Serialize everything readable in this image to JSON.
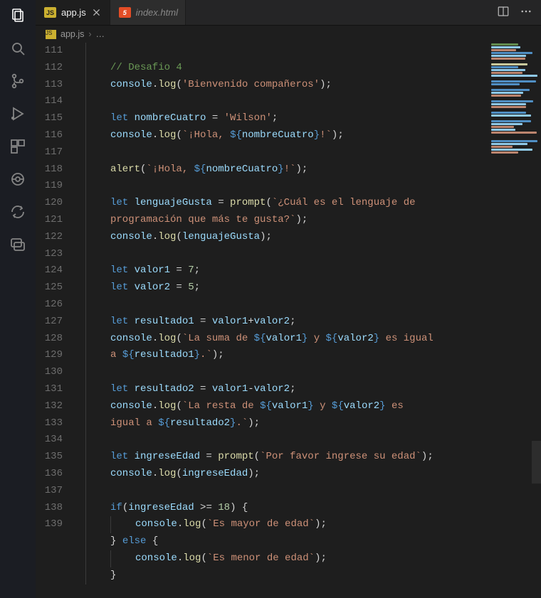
{
  "tabs": [
    {
      "label": "app.js",
      "badge": "JS",
      "active": true
    },
    {
      "label": "index.html",
      "badge": "5",
      "active": false
    }
  ],
  "breadcrumb": {
    "file": "app.js",
    "badge": "JS",
    "trail": "…"
  },
  "gutter_start": 111,
  "code_lines": [
    {
      "n": 111,
      "indent": 1,
      "tokens": []
    },
    {
      "n": 112,
      "indent": 1,
      "tokens": [
        [
          "comment",
          "// Desafio 4"
        ]
      ]
    },
    {
      "n": 113,
      "indent": 1,
      "tokens": [
        [
          "var",
          "console"
        ],
        [
          "punc",
          "."
        ],
        [
          "func",
          "log"
        ],
        [
          "punc",
          "("
        ],
        [
          "string",
          "'Bienvenido compañeros'"
        ],
        [
          "punc",
          ");"
        ]
      ]
    },
    {
      "n": 114,
      "indent": 1,
      "tokens": []
    },
    {
      "n": 115,
      "indent": 1,
      "tokens": [
        [
          "keyword",
          "let "
        ],
        [
          "var",
          "nombreCuatro"
        ],
        [
          "punc",
          " = "
        ],
        [
          "string",
          "'Wilson'"
        ],
        [
          "punc",
          ";"
        ]
      ]
    },
    {
      "n": 116,
      "indent": 1,
      "tokens": [
        [
          "var",
          "console"
        ],
        [
          "punc",
          "."
        ],
        [
          "func",
          "log"
        ],
        [
          "punc",
          "("
        ],
        [
          "string",
          "`¡Hola, "
        ],
        [
          "tpl",
          "${"
        ],
        [
          "var",
          "nombreCuatro"
        ],
        [
          "tpl",
          "}"
        ],
        [
          "string",
          "!`"
        ],
        [
          "punc",
          ");"
        ]
      ]
    },
    {
      "n": 117,
      "indent": 1,
      "tokens": []
    },
    {
      "n": 118,
      "indent": 1,
      "tokens": [
        [
          "func",
          "alert"
        ],
        [
          "punc",
          "("
        ],
        [
          "string",
          "`¡Hola, "
        ],
        [
          "tpl",
          "${"
        ],
        [
          "var",
          "nombreCuatro"
        ],
        [
          "tpl",
          "}"
        ],
        [
          "string",
          "!`"
        ],
        [
          "punc",
          ");"
        ]
      ]
    },
    {
      "n": 119,
      "indent": 1,
      "tokens": []
    },
    {
      "n": 120,
      "indent": 1,
      "tokens": [
        [
          "keyword",
          "let "
        ],
        [
          "var",
          "lenguajeGusta"
        ],
        [
          "punc",
          " = "
        ],
        [
          "func",
          "prompt"
        ],
        [
          "punc",
          "("
        ],
        [
          "string",
          "`¿Cuál es el lenguaje de "
        ]
      ]
    },
    {
      "wrap": true,
      "indent": 1,
      "tokens": [
        [
          "string",
          "programación que más te gusta?`"
        ],
        [
          "punc",
          ");"
        ]
      ]
    },
    {
      "n": 121,
      "indent": 1,
      "tokens": [
        [
          "var",
          "console"
        ],
        [
          "punc",
          "."
        ],
        [
          "func",
          "log"
        ],
        [
          "punc",
          "("
        ],
        [
          "var",
          "lenguajeGusta"
        ],
        [
          "punc",
          ");"
        ]
      ]
    },
    {
      "n": 122,
      "indent": 1,
      "tokens": []
    },
    {
      "n": 123,
      "indent": 1,
      "tokens": [
        [
          "keyword",
          "let "
        ],
        [
          "var",
          "valor1"
        ],
        [
          "punc",
          " = "
        ],
        [
          "number",
          "7"
        ],
        [
          "punc",
          ";"
        ]
      ]
    },
    {
      "n": 124,
      "indent": 1,
      "tokens": [
        [
          "keyword",
          "let "
        ],
        [
          "var",
          "valor2"
        ],
        [
          "punc",
          " = "
        ],
        [
          "number",
          "5"
        ],
        [
          "punc",
          ";"
        ]
      ]
    },
    {
      "n": 125,
      "indent": 1,
      "tokens": []
    },
    {
      "n": 126,
      "indent": 1,
      "tokens": [
        [
          "keyword",
          "let "
        ],
        [
          "var",
          "resultado1"
        ],
        [
          "punc",
          " = "
        ],
        [
          "var",
          "valor1"
        ],
        [
          "punc",
          "+"
        ],
        [
          "var",
          "valor2"
        ],
        [
          "punc",
          ";"
        ]
      ]
    },
    {
      "n": 127,
      "indent": 1,
      "tokens": [
        [
          "var",
          "console"
        ],
        [
          "punc",
          "."
        ],
        [
          "func",
          "log"
        ],
        [
          "punc",
          "("
        ],
        [
          "string",
          "`La suma de "
        ],
        [
          "tpl",
          "${"
        ],
        [
          "var",
          "valor1"
        ],
        [
          "tpl",
          "}"
        ],
        [
          "string",
          " y "
        ],
        [
          "tpl",
          "${"
        ],
        [
          "var",
          "valor2"
        ],
        [
          "tpl",
          "}"
        ],
        [
          "string",
          " es igual "
        ]
      ]
    },
    {
      "wrap": true,
      "indent": 1,
      "tokens": [
        [
          "string",
          "a "
        ],
        [
          "tpl",
          "${"
        ],
        [
          "var",
          "resultado1"
        ],
        [
          "tpl",
          "}"
        ],
        [
          "string",
          ".`"
        ],
        [
          "punc",
          ");"
        ]
      ]
    },
    {
      "n": 128,
      "indent": 1,
      "tokens": []
    },
    {
      "n": 129,
      "indent": 1,
      "tokens": [
        [
          "keyword",
          "let "
        ],
        [
          "var",
          "resultado2"
        ],
        [
          "punc",
          " = "
        ],
        [
          "var",
          "valor1"
        ],
        [
          "punc",
          "-"
        ],
        [
          "var",
          "valor2"
        ],
        [
          "punc",
          ";"
        ]
      ]
    },
    {
      "n": 130,
      "indent": 1,
      "tokens": [
        [
          "var",
          "console"
        ],
        [
          "punc",
          "."
        ],
        [
          "func",
          "log"
        ],
        [
          "punc",
          "("
        ],
        [
          "string",
          "`La resta de "
        ],
        [
          "tpl",
          "${"
        ],
        [
          "var",
          "valor1"
        ],
        [
          "tpl",
          "}"
        ],
        [
          "string",
          " y "
        ],
        [
          "tpl",
          "${"
        ],
        [
          "var",
          "valor2"
        ],
        [
          "tpl",
          "}"
        ],
        [
          "string",
          " es "
        ]
      ]
    },
    {
      "wrap": true,
      "indent": 1,
      "tokens": [
        [
          "string",
          "igual a "
        ],
        [
          "tpl",
          "${"
        ],
        [
          "var",
          "resultado2"
        ],
        [
          "tpl",
          "}"
        ],
        [
          "string",
          ".`"
        ],
        [
          "punc",
          ");"
        ]
      ]
    },
    {
      "n": 131,
      "indent": 1,
      "tokens": []
    },
    {
      "n": 132,
      "indent": 1,
      "tokens": [
        [
          "keyword",
          "let "
        ],
        [
          "var",
          "ingreseEdad"
        ],
        [
          "punc",
          " = "
        ],
        [
          "func",
          "prompt"
        ],
        [
          "punc",
          "("
        ],
        [
          "string",
          "`Por favor ingrese su edad`"
        ],
        [
          "punc",
          ");"
        ]
      ]
    },
    {
      "n": 133,
      "indent": 1,
      "tokens": [
        [
          "var",
          "console"
        ],
        [
          "punc",
          "."
        ],
        [
          "func",
          "log"
        ],
        [
          "punc",
          "("
        ],
        [
          "var",
          "ingreseEdad"
        ],
        [
          "punc",
          ");"
        ]
      ]
    },
    {
      "n": 134,
      "indent": 1,
      "tokens": []
    },
    {
      "n": 135,
      "indent": 1,
      "tokens": [
        [
          "keyword",
          "if"
        ],
        [
          "punc",
          "("
        ],
        [
          "var",
          "ingreseEdad"
        ],
        [
          "punc",
          " >= "
        ],
        [
          "number",
          "18"
        ],
        [
          "punc",
          ") {"
        ]
      ]
    },
    {
      "n": 136,
      "indent": 2,
      "tokens": [
        [
          "var",
          "console"
        ],
        [
          "punc",
          "."
        ],
        [
          "func",
          "log"
        ],
        [
          "punc",
          "("
        ],
        [
          "string",
          "`Es mayor de edad`"
        ],
        [
          "punc",
          ");"
        ]
      ]
    },
    {
      "n": 137,
      "indent": 1,
      "tokens": [
        [
          "punc",
          "} "
        ],
        [
          "keyword",
          "else"
        ],
        [
          "punc",
          " {"
        ]
      ]
    },
    {
      "n": 138,
      "indent": 2,
      "tokens": [
        [
          "var",
          "console"
        ],
        [
          "punc",
          "."
        ],
        [
          "func",
          "log"
        ],
        [
          "punc",
          "("
        ],
        [
          "string",
          "`Es menor de edad`"
        ],
        [
          "punc",
          ");"
        ]
      ]
    },
    {
      "n": 139,
      "indent": 1,
      "tokens": [
        [
          "punc",
          "}"
        ]
      ]
    }
  ],
  "token_class_map": {
    "comment": "c-comment",
    "keyword": "c-keyword",
    "var": "c-var",
    "func": "c-func",
    "string": "c-string",
    "number": "c-number",
    "punc": "c-punc",
    "tpl": "c-tpl"
  },
  "minimap_pattern": [
    "#6a9955",
    "#9cdcfe",
    "#ce9178",
    "#569cd6",
    "#9cdcfe",
    "#ce9178",
    "",
    "#dcdcaa",
    "#569cd6",
    "#9cdcfe",
    "#ce9178",
    "#9cdcfe",
    "",
    "#569cd6",
    "#569cd6",
    "",
    "#569cd6",
    "#9cdcfe",
    "#ce9178",
    "",
    "#569cd6",
    "#9cdcfe",
    "#ce9178",
    "",
    "#569cd6",
    "#9cdcfe",
    "",
    "#569cd6",
    "#9cdcfe",
    "#ce9178",
    "#9cdcfe",
    "#ce9178",
    "",
    "",
    "#569cd6",
    "#9cdcfe",
    "#ce9178",
    "#9cdcfe",
    "#ce9178"
  ]
}
